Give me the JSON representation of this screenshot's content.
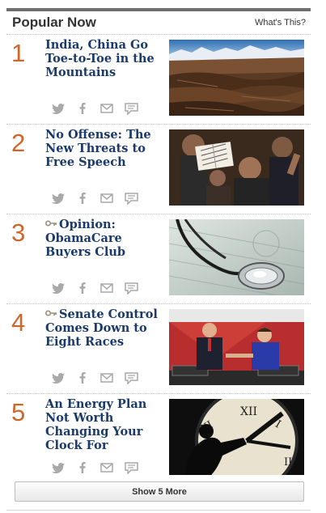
{
  "header": {
    "title": "Popular Now",
    "whats_this": "What's This?"
  },
  "items": [
    {
      "rank": "1",
      "headline": "India, China Go Toe-to-Toe in the Mountains",
      "premium": false
    },
    {
      "rank": "2",
      "headline": "No Offense: The New Threats to Free Speech",
      "premium": false
    },
    {
      "rank": "3",
      "headline": "Opinion: ObamaCare Buyers Club",
      "premium": true
    },
    {
      "rank": "4",
      "headline": "Senate Control Comes Down to Eight Races",
      "premium": true
    },
    {
      "rank": "5",
      "headline": "An Energy Plan Not Worth Changing Your Clock For",
      "premium": false
    }
  ],
  "share_icons": [
    "twitter-icon",
    "facebook-icon",
    "email-icon",
    "comment-icon"
  ],
  "footer": {
    "show_more": "Show 5 More"
  },
  "colors": {
    "rank": "#d0672a",
    "headline": "#1a3a6b",
    "topbar": "#6f6f6f"
  }
}
